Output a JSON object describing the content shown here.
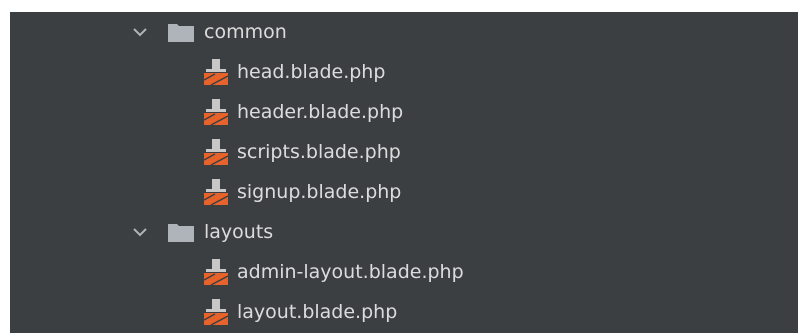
{
  "tree": {
    "folders": [
      {
        "name": "common",
        "expanded": true,
        "icon": "folder-icon",
        "files": [
          {
            "name": "head.blade.php",
            "icon": "blade-file-icon"
          },
          {
            "name": "header.blade.php",
            "icon": "blade-file-icon"
          },
          {
            "name": "scripts.blade.php",
            "icon": "blade-file-icon"
          },
          {
            "name": "signup.blade.php",
            "icon": "blade-file-icon"
          }
        ]
      },
      {
        "name": "layouts",
        "expanded": true,
        "icon": "folder-icon",
        "files": [
          {
            "name": "admin-layout.blade.php",
            "icon": "blade-file-icon"
          },
          {
            "name": "layout.blade.php",
            "icon": "blade-file-icon"
          }
        ]
      }
    ]
  },
  "colors": {
    "background": "#3c3f41",
    "text": "#dcdcdc",
    "folder": "#aeb4ba",
    "blade_orange": "#e8632b",
    "blade_gray": "#c8c8c8"
  }
}
